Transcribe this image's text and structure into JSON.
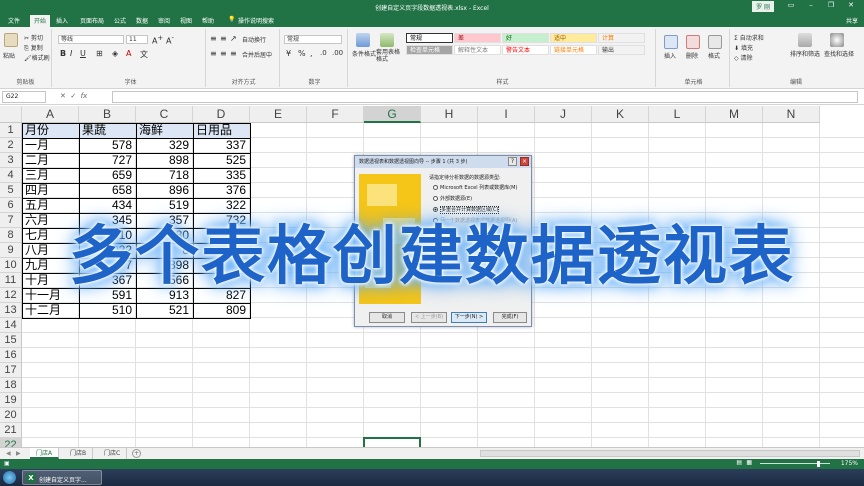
{
  "window": {
    "title": "创建自定义页字段数据透视表.xlsx - Excel",
    "user": "罗 刚"
  },
  "menu": {
    "tabs": [
      "文件",
      "开始",
      "插入",
      "页面布局",
      "公式",
      "数据",
      "审阅",
      "视图",
      "帮助",
      "操作说明搜索"
    ],
    "active": "开始",
    "share": "共享"
  },
  "ribbon": {
    "clipboard": {
      "label": "剪贴板",
      "cut": "剪切",
      "copy": "复制",
      "format_painter": "格式刷",
      "paste": "粘贴"
    },
    "font": {
      "label": "字体",
      "font_name": "等线",
      "font_size": "11"
    },
    "alignment": {
      "label": "对齐方式",
      "wrap": "自动换行",
      "merge": "合并后居中"
    },
    "number": {
      "label": "数字",
      "format": "常规"
    },
    "styles": {
      "label": "样式",
      "conditional": "条件格式",
      "table_format": "套用表格格式",
      "cells": [
        {
          "text": "常规",
          "bg": "#ffffff",
          "fg": "#000000"
        },
        {
          "text": "差",
          "bg": "#ffc7ce",
          "fg": "#9c0006"
        },
        {
          "text": "好",
          "bg": "#c6efce",
          "fg": "#006100"
        },
        {
          "text": "适中",
          "bg": "#ffeb9c",
          "fg": "#9c5700"
        },
        {
          "text": "计算",
          "bg": "#f2f2f2",
          "fg": "#fa7d00"
        },
        {
          "text": "检查单元格",
          "bg": "#a5a5a5",
          "fg": "#ffffff"
        },
        {
          "text": "解释性文本",
          "bg": "#ffffff",
          "fg": "#7f7f7f"
        },
        {
          "text": "警告文本",
          "bg": "#ffffff",
          "fg": "#ff0000"
        },
        {
          "text": "链接单元格",
          "bg": "#ffffff",
          "fg": "#fa7d00"
        },
        {
          "text": "输出",
          "bg": "#f2f2f2",
          "fg": "#3f3f3f"
        }
      ]
    },
    "cells_group": {
      "label": "单元格",
      "insert": "插入",
      "delete": "删除",
      "format": "格式"
    },
    "editing": {
      "label": "编辑",
      "autosum": "自动求和",
      "fill": "填充",
      "clear": "清除",
      "sort": "排序和筛选",
      "find": "查找和选择"
    }
  },
  "formula_bar": {
    "name_box": "G22",
    "fx": "fx",
    "value": ""
  },
  "columns": [
    "A",
    "B",
    "C",
    "D",
    "E",
    "F",
    "G",
    "H",
    "I",
    "J",
    "K",
    "L",
    "M",
    "N"
  ],
  "rows": [
    "1",
    "2",
    "3",
    "4",
    "5",
    "6",
    "7",
    "8",
    "9",
    "10",
    "11",
    "12",
    "13",
    "14",
    "15",
    "16",
    "17",
    "18",
    "19",
    "20",
    "21",
    "22"
  ],
  "table": {
    "headers": [
      "月份",
      "果蔬",
      "海鲜",
      "日用品"
    ],
    "rows": [
      [
        "一月",
        "578",
        "329",
        "337"
      ],
      [
        "二月",
        "727",
        "898",
        "525"
      ],
      [
        "三月",
        "659",
        "718",
        "335"
      ],
      [
        "四月",
        "658",
        "896",
        "376"
      ],
      [
        "五月",
        "434",
        "519",
        "322"
      ],
      [
        "六月",
        "345",
        "357",
        "732"
      ],
      [
        "七月",
        "510",
        "380",
        ""
      ],
      [
        "八月",
        "922",
        "8",
        ""
      ],
      [
        "九月",
        "7",
        "898",
        ""
      ],
      [
        "十月",
        "367",
        "566",
        ""
      ],
      [
        "十一月",
        "591",
        "913",
        "827"
      ],
      [
        "十二月",
        "510",
        "521",
        "809"
      ]
    ]
  },
  "dialog": {
    "title": "数据透视表和数据透视图向导 -- 步骤 1 (共 3 步)",
    "help": "?",
    "close": "×",
    "prompt": "请指定待分析数据的数据源类型:",
    "options": [
      {
        "label": "Microsoft Excel 列表或数据库(M)",
        "selected": false,
        "disabled": false
      },
      {
        "label": "外部数据源(E)",
        "selected": false,
        "disabled": false
      },
      {
        "label": "多重合并计算数据区域(C)",
        "selected": true,
        "disabled": false
      },
      {
        "label": "另一个数据透视表或数据透视图(A)",
        "selected": false,
        "disabled": true
      }
    ],
    "buttons": {
      "cancel": "取消",
      "back": "< 上一步(B)",
      "next": "下一步(N) >",
      "finish": "完成(F)"
    }
  },
  "caption": "多个表格创建数据透视表",
  "sheets": {
    "tabs": [
      "门店A",
      "门店B",
      "门店C"
    ],
    "active": "门店A",
    "add": "+"
  },
  "status": {
    "zoom": "175%"
  },
  "taskbar": {
    "app_label": "创建自定义页字..."
  }
}
